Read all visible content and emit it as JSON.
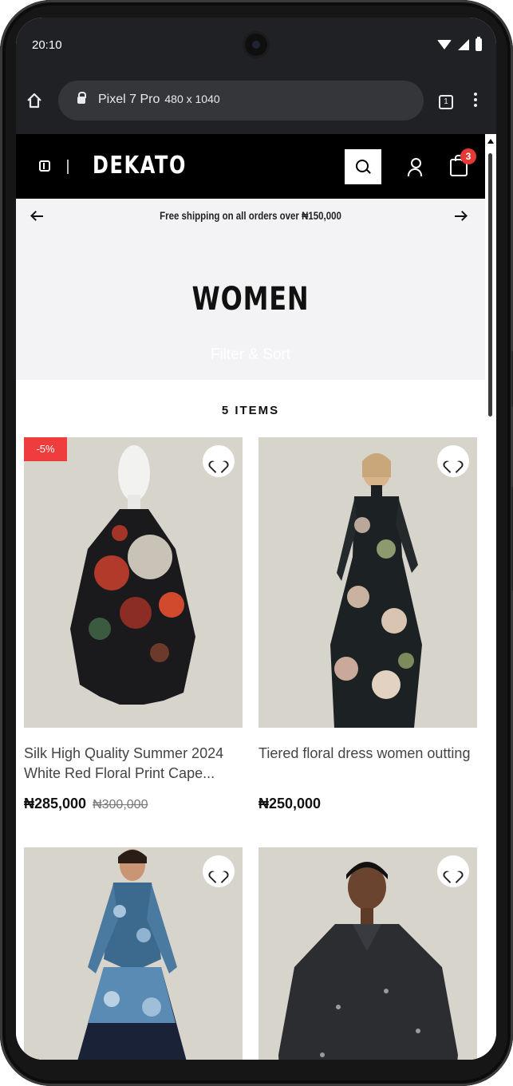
{
  "status_bar": {
    "time": "20:10"
  },
  "browser": {
    "url_title": "Pixel 7 Pro",
    "url_dims": "480 x 1040",
    "tab_count": "1"
  },
  "header": {
    "brand": "DEKATO",
    "cart_count": "3",
    "icons": [
      "sidebar-icon",
      "search-icon",
      "user-icon",
      "bag-icon"
    ]
  },
  "announcement": {
    "text": "Free shipping on all orders over ₦150,000"
  },
  "hero": {
    "title": "WOMEN",
    "filter_label": "Filter & Sort"
  },
  "collection": {
    "count_label": "5 ITEMS"
  },
  "products": [
    {
      "title": "Silk High Quality Summer 2024 White Red Floral Print Cape...",
      "price": "₦285,000",
      "old_price": "₦300,000",
      "badge": "-5%"
    },
    {
      "title": "Tiered floral dress women outting",
      "price": "₦250,000"
    },
    {
      "title": "",
      "price": ""
    },
    {
      "title": "",
      "price": ""
    }
  ],
  "colors": {
    "accent": "#ef3d3d",
    "header_bg": "#000000",
    "announce_bg": "#f3f3f5",
    "image_bg": "#d7d4cc"
  }
}
